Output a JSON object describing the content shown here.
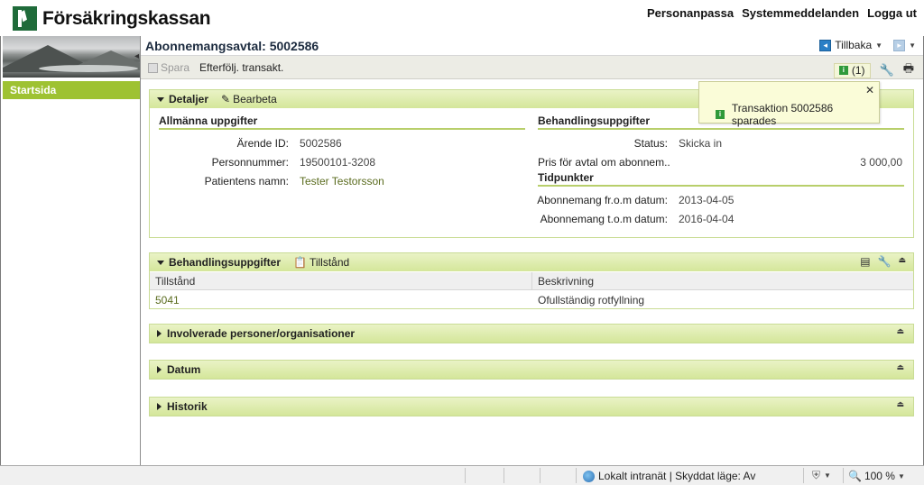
{
  "header": {
    "logo_text": "Försäkringskassan",
    "links": [
      "Personanpassa",
      "Systemmeddelanden",
      "Logga ut"
    ]
  },
  "sidebar": {
    "start_label": "Startsida"
  },
  "title_bar": {
    "title": "Abonnemangsavtal: 5002586",
    "back_label": "Tillbaka"
  },
  "toolbar": {
    "save_label": "Spara",
    "follow_label": "Efterfölj. transakt.",
    "notification_count": "(1)"
  },
  "notification": {
    "message": "Transaktion 5002586 sparades"
  },
  "detaljer": {
    "head_label": "Detaljer",
    "edit_label": "Bearbeta",
    "general": {
      "title": "Allmänna uppgifter",
      "rows": [
        {
          "label": "Ärende ID:",
          "value": "5002586"
        },
        {
          "label": "Personnummer:",
          "value": "19500101-3208"
        },
        {
          "label": "Patientens namn:",
          "value": "Tester Testorsson"
        }
      ]
    },
    "treatment": {
      "title": "Behandlingsuppgifter",
      "status_label": "Status:",
      "status_value": "Skicka in",
      "price_label": "Pris för avtal om abonnem..",
      "price_value": "3 000,00"
    },
    "timepoints": {
      "title": "Tidpunkter",
      "rows": [
        {
          "label": "Abonnemang fr.o.m datum:",
          "value": "2013-04-05"
        },
        {
          "label": "Abonnemang t.o.m datum:",
          "value": "2016-04-04"
        }
      ]
    }
  },
  "behandling": {
    "head_label": "Behandlingsuppgifter",
    "action_label": "Tillstånd",
    "columns": [
      "Tillstånd",
      "Beskrivning"
    ],
    "rows": [
      [
        "5041",
        "Ofullständig rotfyllning"
      ]
    ]
  },
  "collapsed_panels": [
    "Involverade personer/organisationer",
    "Datum",
    "Historik"
  ],
  "status_bar": {
    "zone": "Lokalt intranät | Skyddat läge: Av",
    "zoom": "100 %"
  },
  "colors": {
    "accent_green": "#9ec232",
    "brand_green": "#1f6b3a",
    "title_blue": "#1c2b3f"
  }
}
